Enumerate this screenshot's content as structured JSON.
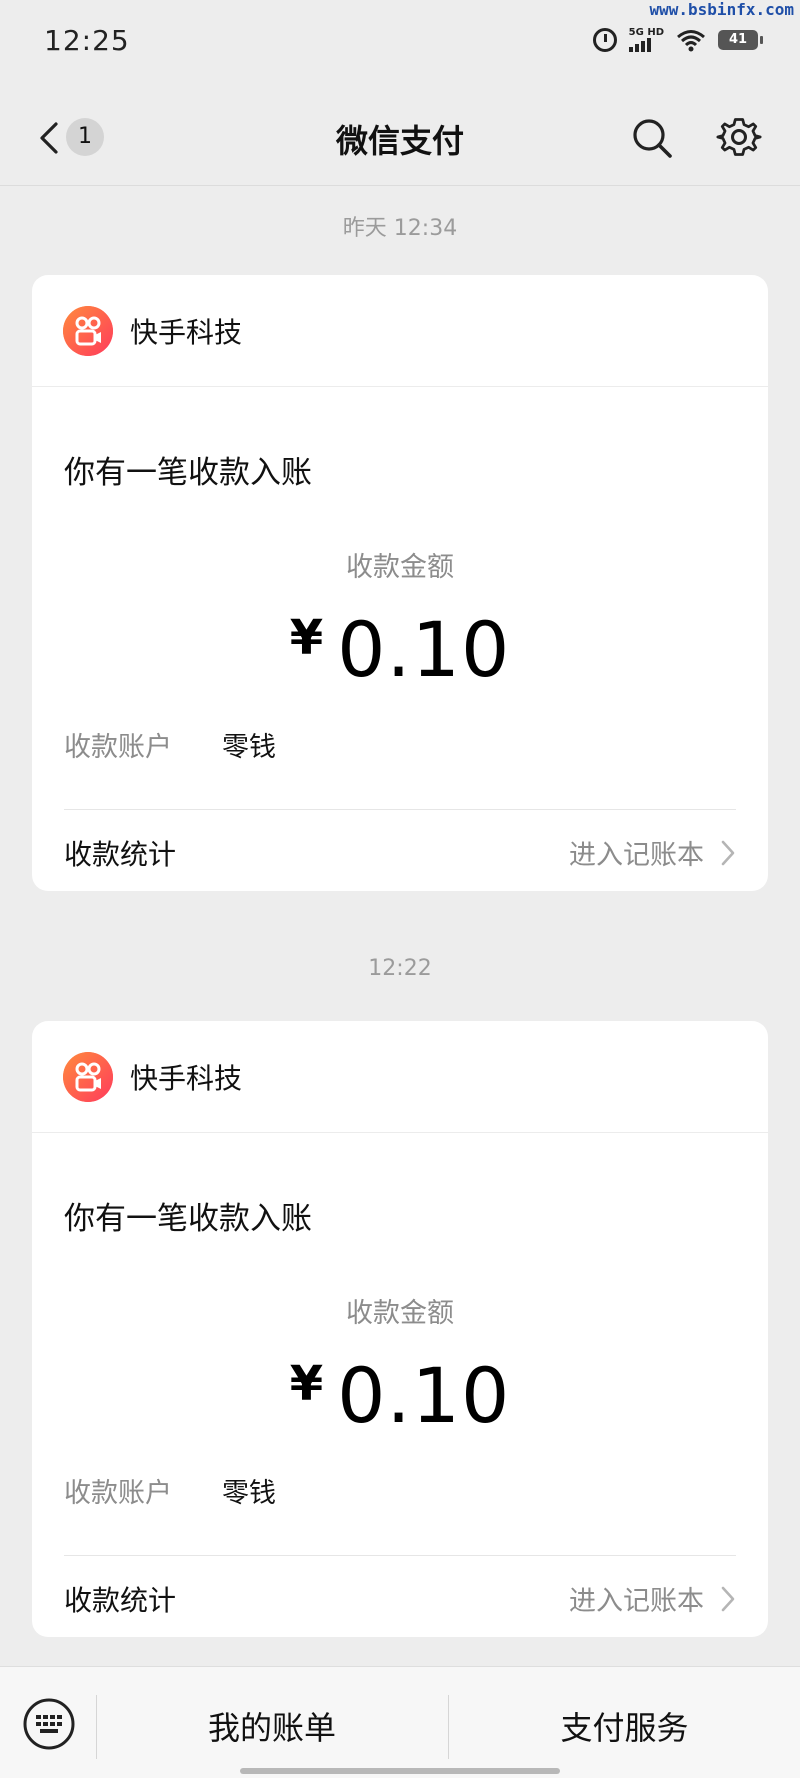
{
  "watermark": "www.bsbinfx.com",
  "status_bar": {
    "time": "12:25",
    "network_label": "5G HD",
    "battery": "41"
  },
  "nav": {
    "unread_count": "1",
    "title": "微信支付"
  },
  "messages": [
    {
      "timestamp": "昨天 12:34",
      "merchant": "快手科技",
      "headline": "你有一笔收款入账",
      "amount_label": "收款金额",
      "currency": "¥",
      "amount": "0.10",
      "account_label": "收款账户",
      "account_value": "零钱",
      "stats_label": "收款统计",
      "stats_link": "进入记账本"
    },
    {
      "timestamp": "12:22",
      "merchant": "快手科技",
      "headline": "你有一笔收款入账",
      "amount_label": "收款金额",
      "currency": "¥",
      "amount": "0.10",
      "account_label": "收款账户",
      "account_value": "零钱",
      "stats_label": "收款统计",
      "stats_link": "进入记账本"
    }
  ],
  "bottom_menu": {
    "items": [
      {
        "label": "我的账单"
      },
      {
        "label": "支付服务"
      }
    ]
  },
  "icons": {
    "back": "chevron-left-icon",
    "search": "search-icon",
    "settings": "gear-icon",
    "keyboard": "keyboard-icon",
    "merchant_logo": "kuaishou-logo"
  },
  "colors": {
    "page_bg": "#ededed",
    "card_bg": "#ffffff",
    "secondary_text": "#8c8c8c",
    "logo_gradient_start": "#ff8a3d",
    "logo_gradient_end": "#ff3b5c"
  }
}
